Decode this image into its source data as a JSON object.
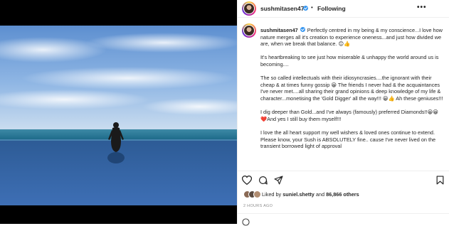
{
  "post": {
    "username": "sushmitasen47",
    "follow_label": "Following",
    "dot": "•",
    "more": "•••"
  },
  "caption": {
    "p1": "Perfectly centred in my being & my conscience...I love how nature merges all it's creation to experience oneness...and just how divided we are, when we break that balance. 😊👍",
    "p2": "It's heartbreaking to see just how miserable & unhappy the world around us is becoming....",
    "p3": "The so called intellectuals with their idiosyncrasies....the ignorant with their cheap & at times funny gossip 😀 The friends I never had & the acquaintances I've never met....all sharing their grand opinions & deep knowledge of my life & character...monetising the 'Gold Digger' all the way!!! 😀👍 Ah these geniuses!!!",
    "p4": "I dig deeper than Gold...and I've always (famously) preferred Diamonds!!😀😀❤️And yes I still buy them myself!!!",
    "p5": "I love the all heart support my well wishers & loved ones continue to extend. Please know, your Sush is ABSOLUTELY fine.. cause I've never lived on the transient borrowed light of approval"
  },
  "likes": {
    "prefix": "Liked by ",
    "user": "suniel.shetty",
    "connector": " and ",
    "count": "86,866 others"
  },
  "timestamp": "2 HOURS AGO",
  "icons": [
    "heart-icon",
    "comment-icon",
    "share-icon",
    "bookmark-icon",
    "verified-badge-icon"
  ],
  "colors": {
    "verified": "#3897f0",
    "text": "#262626",
    "secondary": "#8e8e8e",
    "divider": "#efefef"
  }
}
